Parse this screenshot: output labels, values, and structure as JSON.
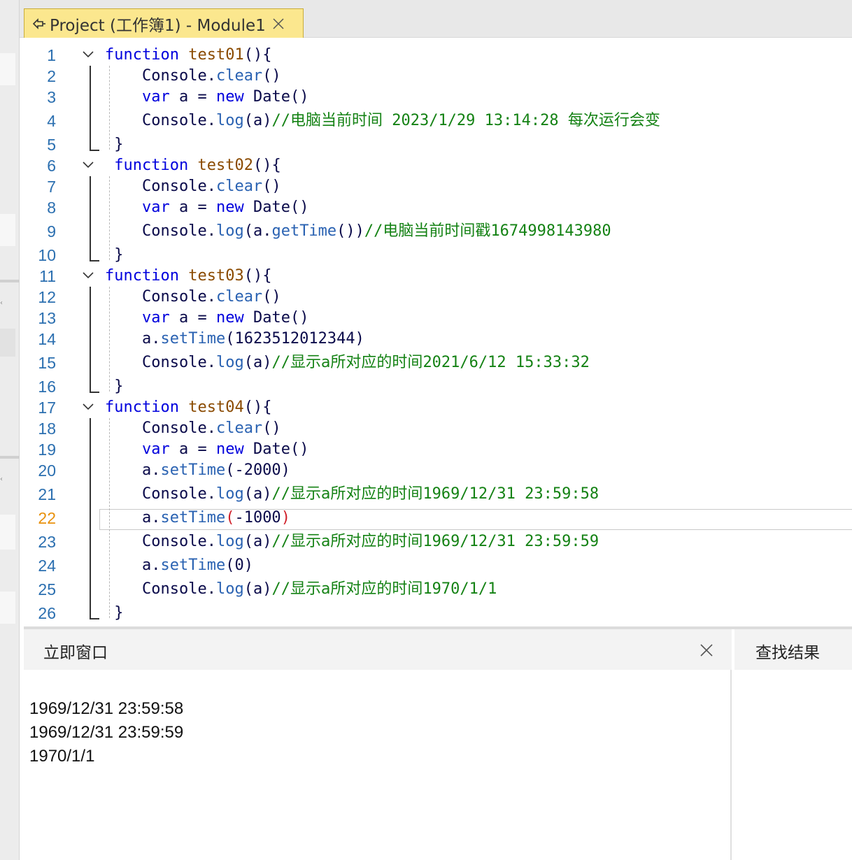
{
  "tab": {
    "label": "Project (工作簿1) - Module1",
    "icon": "module-icon",
    "close_icon": "close-icon"
  },
  "editor": {
    "current_line": 22,
    "lines": [
      {
        "n": "1",
        "tokens": [
          [
            "kw",
            "function"
          ],
          [
            "tx",
            " "
          ],
          [
            "fn",
            "test01"
          ],
          [
            "tx",
            "(){"
          ]
        ]
      },
      {
        "n": "2",
        "tokens": [
          [
            "tx",
            "    Console."
          ],
          [
            "pr",
            "clear"
          ],
          [
            "tx",
            "()"
          ]
        ]
      },
      {
        "n": "3",
        "tokens": [
          [
            "tx",
            "    "
          ],
          [
            "kw",
            "var"
          ],
          [
            "tx",
            " a = "
          ],
          [
            "kw",
            "new"
          ],
          [
            "tx",
            " Date()"
          ]
        ]
      },
      {
        "n": "4",
        "tokens": [
          [
            "tx",
            "    Console."
          ],
          [
            "pr",
            "log"
          ],
          [
            "tx",
            "(a)"
          ],
          [
            "cm",
            "//"
          ],
          [
            "cmc",
            "电脑当前时间"
          ],
          [
            "cm",
            " 2023/1/29 13:14:28 "
          ],
          [
            "cmc",
            "每次运行会变"
          ]
        ]
      },
      {
        "n": "5",
        "tokens": [
          [
            "tx",
            " }"
          ]
        ]
      },
      {
        "n": "6",
        "tokens": [
          [
            "kw",
            " function"
          ],
          [
            "tx",
            " "
          ],
          [
            "fn",
            "test02"
          ],
          [
            "tx",
            "(){"
          ]
        ]
      },
      {
        "n": "7",
        "tokens": [
          [
            "tx",
            "    Console."
          ],
          [
            "pr",
            "clear"
          ],
          [
            "tx",
            "()"
          ]
        ]
      },
      {
        "n": "8",
        "tokens": [
          [
            "tx",
            "    "
          ],
          [
            "kw",
            "var"
          ],
          [
            "tx",
            " a = "
          ],
          [
            "kw",
            "new"
          ],
          [
            "tx",
            " Date()"
          ]
        ]
      },
      {
        "n": "9",
        "tokens": [
          [
            "tx",
            "    Console."
          ],
          [
            "pr",
            "log"
          ],
          [
            "tx",
            "(a."
          ],
          [
            "pr",
            "getTime"
          ],
          [
            "tx",
            "())"
          ],
          [
            "cm",
            "//"
          ],
          [
            "cmc",
            "电脑当前时间戳"
          ],
          [
            "cm",
            "1674998143980"
          ]
        ]
      },
      {
        "n": "10",
        "tokens": [
          [
            "tx",
            " }"
          ]
        ]
      },
      {
        "n": "11",
        "tokens": [
          [
            "kw",
            "function"
          ],
          [
            "tx",
            " "
          ],
          [
            "fn",
            "test03"
          ],
          [
            "tx",
            "(){"
          ]
        ]
      },
      {
        "n": "12",
        "tokens": [
          [
            "tx",
            "    Console."
          ],
          [
            "pr",
            "clear"
          ],
          [
            "tx",
            "()"
          ]
        ]
      },
      {
        "n": "13",
        "tokens": [
          [
            "tx",
            "    "
          ],
          [
            "kw",
            "var"
          ],
          [
            "tx",
            " a = "
          ],
          [
            "kw",
            "new"
          ],
          [
            "tx",
            " Date()"
          ]
        ]
      },
      {
        "n": "14",
        "tokens": [
          [
            "tx",
            "    a."
          ],
          [
            "pr",
            "setTime"
          ],
          [
            "tx",
            "(1623512012344)"
          ]
        ]
      },
      {
        "n": "15",
        "tokens": [
          [
            "tx",
            "    Console."
          ],
          [
            "pr",
            "log"
          ],
          [
            "tx",
            "(a)"
          ],
          [
            "cm",
            "//"
          ],
          [
            "cmc",
            "显示a所对应的时间"
          ],
          [
            "cm",
            "2021/6/12 15:33:32"
          ]
        ]
      },
      {
        "n": "16",
        "tokens": [
          [
            "tx",
            " }"
          ]
        ]
      },
      {
        "n": "17",
        "tokens": [
          [
            "kw",
            "function"
          ],
          [
            "tx",
            " "
          ],
          [
            "fn",
            "test04"
          ],
          [
            "tx",
            "(){"
          ]
        ]
      },
      {
        "n": "18",
        "tokens": [
          [
            "tx",
            "    Console."
          ],
          [
            "pr",
            "clear"
          ],
          [
            "tx",
            "()"
          ]
        ]
      },
      {
        "n": "19",
        "tokens": [
          [
            "tx",
            "    "
          ],
          [
            "kw",
            "var"
          ],
          [
            "tx",
            " a = "
          ],
          [
            "kw",
            "new"
          ],
          [
            "tx",
            " Date()"
          ]
        ]
      },
      {
        "n": "20",
        "tokens": [
          [
            "tx",
            "    a."
          ],
          [
            "pr",
            "setTime"
          ],
          [
            "tx",
            "(-2000)"
          ]
        ]
      },
      {
        "n": "21",
        "tokens": [
          [
            "tx",
            "    Console."
          ],
          [
            "pr",
            "log"
          ],
          [
            "tx",
            "(a)"
          ],
          [
            "cm",
            "//"
          ],
          [
            "cmc",
            "显示a所对应的时间"
          ],
          [
            "cm",
            "1969/12/31 23:59:58"
          ]
        ]
      },
      {
        "n": "22",
        "tokens": [
          [
            "tx",
            "    a."
          ],
          [
            "pr",
            "setTime"
          ],
          [
            "tk-red",
            "("
          ],
          [
            "tx",
            "-1000"
          ],
          [
            "tk-red",
            ")"
          ]
        ]
      },
      {
        "n": "23",
        "tokens": [
          [
            "tx",
            "    Console."
          ],
          [
            "pr",
            "log"
          ],
          [
            "tx",
            "(a)"
          ],
          [
            "cm",
            "//"
          ],
          [
            "cmc",
            "显示a所对应的时间"
          ],
          [
            "cm",
            "1969/12/31 23:59:59"
          ]
        ]
      },
      {
        "n": "24",
        "tokens": [
          [
            "tx",
            "    a."
          ],
          [
            "pr",
            "setTime"
          ],
          [
            "tx",
            "(0)"
          ]
        ]
      },
      {
        "n": "25",
        "tokens": [
          [
            "tx",
            "    Console."
          ],
          [
            "pr",
            "log"
          ],
          [
            "tx",
            "(a)"
          ],
          [
            "cm",
            "//"
          ],
          [
            "cmc",
            "显示a所对应的时间"
          ],
          [
            "cm",
            "1970/1/1"
          ]
        ]
      },
      {
        "n": "26",
        "tokens": [
          [
            "tx",
            " }"
          ]
        ]
      }
    ]
  },
  "immediate": {
    "title": "立即窗口",
    "output": [
      "1969/12/31 23:59:58",
      "1969/12/31 23:59:59",
      "1970/1/1"
    ]
  },
  "find_results": {
    "title": "查找结果"
  },
  "colors": {
    "keyword": "#0000dd",
    "function_name": "#8a4a00",
    "property": "#2a62b2",
    "comment": "#148214",
    "line_number": "#2b6fb0",
    "current_line_number": "#e8910c",
    "tab_active": "#fbe78e"
  }
}
